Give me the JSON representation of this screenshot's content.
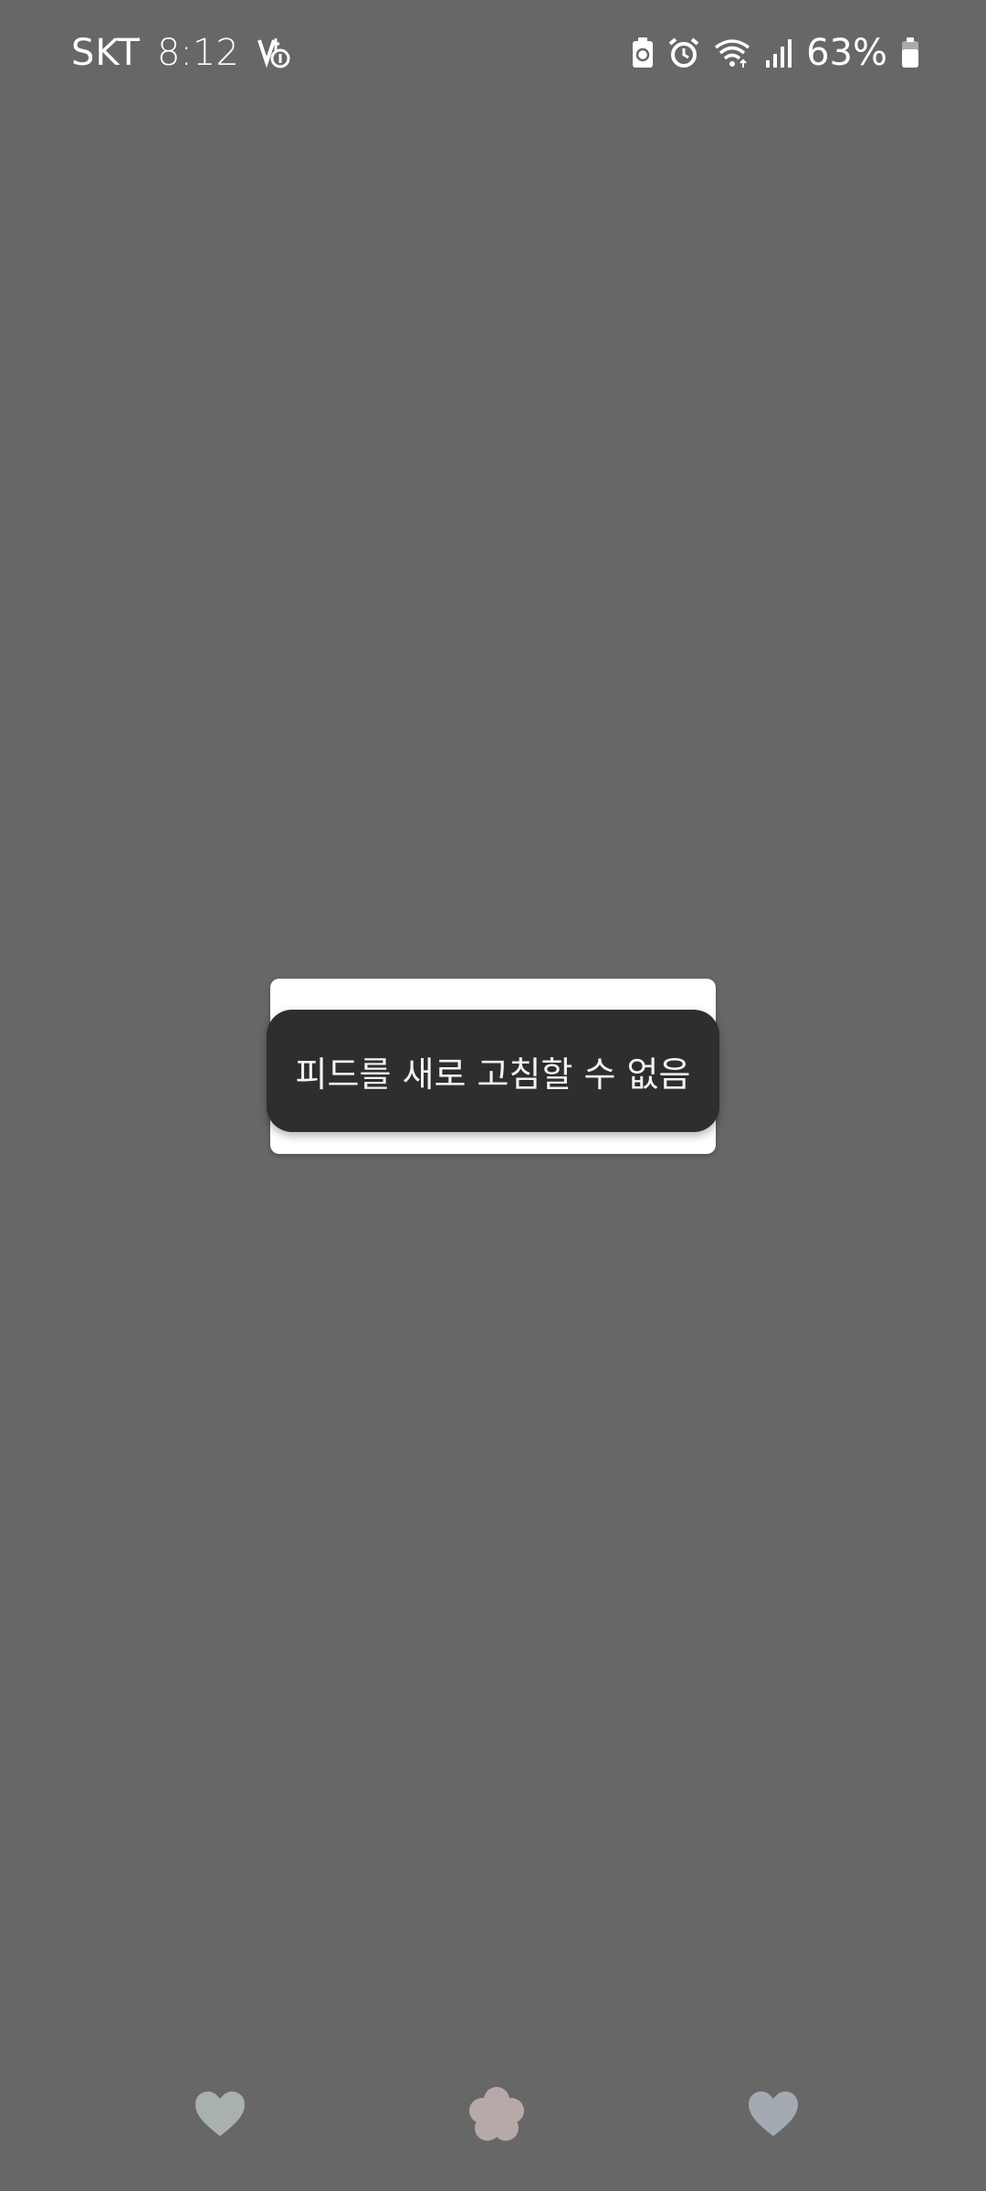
{
  "status_bar": {
    "carrier": "SKT",
    "time": "8:12",
    "battery_percent": "63%",
    "icons_left": [
      "volte-icon"
    ],
    "icons_right": [
      "battery-saver-icon",
      "alarm-icon",
      "wifi-icon",
      "signal-icon",
      "battery-icon"
    ]
  },
  "toast": {
    "message": "피드를 새로 고침할 수 없음"
  },
  "bottom_decorations": [
    {
      "icon": "heart-icon",
      "color": "#a9b1ae"
    },
    {
      "icon": "flower-icon",
      "color": "#b6a9a7"
    },
    {
      "icon": "heart-icon",
      "color": "#a4aab2"
    }
  ],
  "colors": {
    "background": "#676767",
    "dialog": "#ffffff",
    "toast": "#2e2e2e"
  }
}
